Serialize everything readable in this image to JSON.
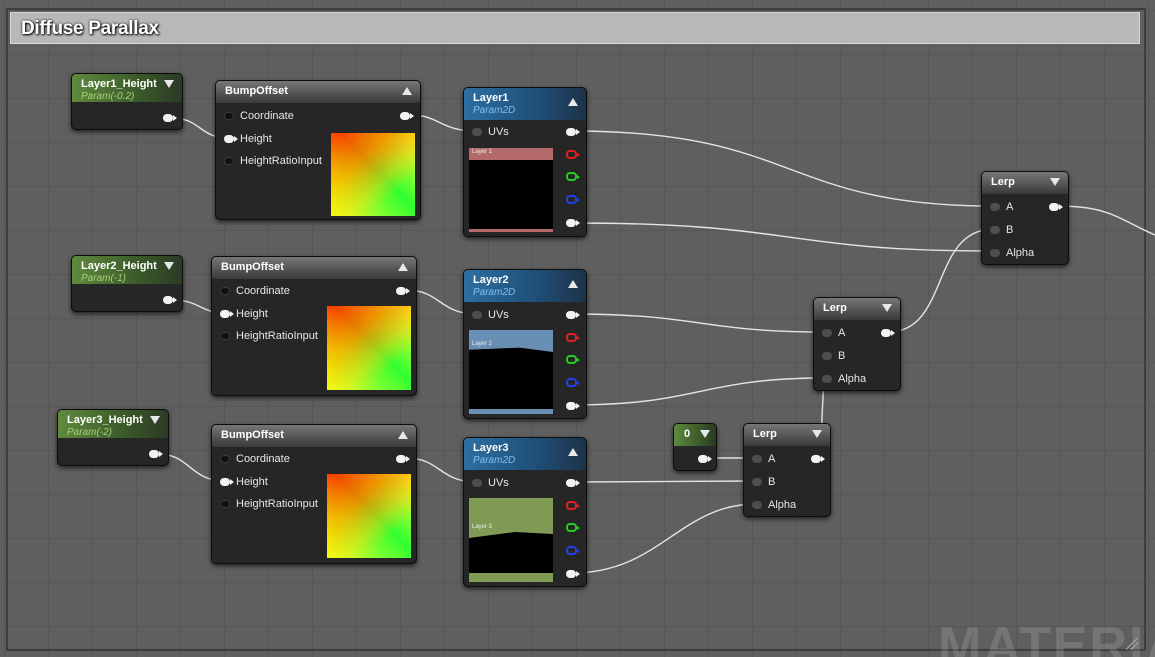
{
  "comment": {
    "title": "Diffuse Parallax"
  },
  "watermark": "MATERIAL",
  "params": [
    {
      "title": "Layer1_Height",
      "subtitle": "Param(-0.2)"
    },
    {
      "title": "Layer2_Height",
      "subtitle": "Param(-1)"
    },
    {
      "title": "Layer3_Height",
      "subtitle": "Param(-2)"
    }
  ],
  "bump_offset": {
    "title": "BumpOffset",
    "inputs": [
      "Coordinate",
      "Height",
      "HeightRatioInput"
    ]
  },
  "textures": [
    {
      "title": "Layer1",
      "subtitle": "Param2D",
      "input": "UVs",
      "preview_tag": "Layer 1",
      "tint": "#b46a6a"
    },
    {
      "title": "Layer2",
      "subtitle": "Param2D",
      "input": "UVs",
      "preview_tag": "Layer 2",
      "tint": "#6a8fb4"
    },
    {
      "title": "Layer3",
      "subtitle": "Param2D",
      "input": "UVs",
      "preview_tag": "Layer 3",
      "tint": "#7f9a55"
    }
  ],
  "constant": {
    "title": "0"
  },
  "lerp": {
    "title": "Lerp",
    "inputs": [
      "A",
      "B",
      "Alpha"
    ]
  },
  "pin_colors": {
    "red": "#e02020",
    "green": "#20d020",
    "blue": "#2040e8",
    "white": "#f2f2f2"
  }
}
